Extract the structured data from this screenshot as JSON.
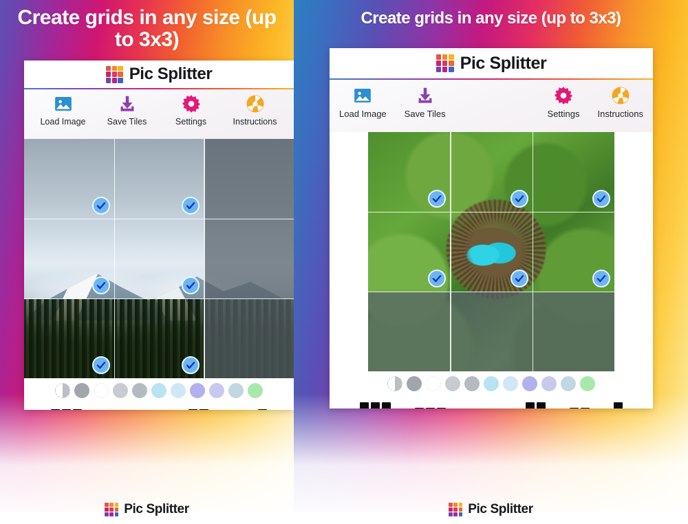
{
  "app": {
    "name": "Pic Splitter",
    "logo_colors": [
      [
        "#e8524a",
        "#f2882c",
        "#fbb321"
      ],
      [
        "#c9246d",
        "#d93a64",
        "#e86a2e"
      ],
      [
        "#7b3fb0",
        "#b2248a",
        "#3f63c4"
      ]
    ]
  },
  "panels": [
    {
      "id": "left",
      "headline": "Create grids in any size (up to 3x3)",
      "toolbar": [
        {
          "label": "Load Image",
          "icon": "image-icon",
          "color": "#2b8fd4"
        },
        {
          "label": "Save Tiles",
          "icon": "download-icon",
          "color": "#8e3fb0"
        },
        {
          "label": "Settings",
          "icon": "gear-icon",
          "color": "#e3197a"
        },
        {
          "label": "Instructions",
          "icon": "help-wheel-icon",
          "color": "#f5a623"
        }
      ],
      "photo": "mountain-landscape",
      "grid": {
        "cols": 3,
        "rows": 3
      },
      "tiles": [
        {
          "selected": true,
          "dimmed": false
        },
        {
          "selected": true,
          "dimmed": false
        },
        {
          "selected": false,
          "dimmed": true
        },
        {
          "selected": true,
          "dimmed": false
        },
        {
          "selected": true,
          "dimmed": false
        },
        {
          "selected": false,
          "dimmed": true
        },
        {
          "selected": true,
          "dimmed": false
        },
        {
          "selected": true,
          "dimmed": false
        },
        {
          "selected": false,
          "dimmed": true
        }
      ],
      "swatches": [
        "half",
        "#a0a6ab",
        "#ffffff",
        "#c8ccd1",
        "#b4bac0",
        "#b8e4f2",
        "#cfe7f6",
        "#b3b0ee",
        "#c9c9ee",
        "#c1d7e4",
        "#a8e8ac"
      ],
      "patterns": [
        {
          "name": "grid-3x3",
          "cols": 3,
          "rows": 3
        },
        {
          "name": "grid-3x2",
          "cols": 3,
          "rows": 2
        },
        {
          "name": "grid-3x1",
          "cols": 3,
          "rows": 1
        },
        {
          "name": "grid-2x3",
          "cols": 2,
          "rows": 3
        },
        {
          "name": "grid-2x2",
          "cols": 2,
          "rows": 2
        },
        {
          "name": "grid-1x3",
          "cols": 1,
          "rows": 3
        }
      ],
      "bottom_bar": {
        "grid_button": "grid-toggle-icon",
        "frame_button": "frame-border-icon"
      }
    },
    {
      "id": "right",
      "headline": "Create grids in any size (up to 3x3)",
      "toolbar": [
        {
          "label": "Load Image",
          "icon": "image-icon",
          "color": "#2b8fd4"
        },
        {
          "label": "Save Tiles",
          "icon": "download-icon",
          "color": "#8e3fb0"
        },
        {
          "label": "Settings",
          "icon": "gear-icon",
          "color": "#e3197a"
        },
        {
          "label": "Instructions",
          "icon": "help-wheel-icon",
          "color": "#f5a623"
        }
      ],
      "photo": "bird-nest-with-eggs",
      "grid": {
        "cols": 3,
        "rows": 3
      },
      "tiles": [
        {
          "selected": true,
          "dimmed": false
        },
        {
          "selected": true,
          "dimmed": false
        },
        {
          "selected": true,
          "dimmed": false
        },
        {
          "selected": true,
          "dimmed": false
        },
        {
          "selected": true,
          "dimmed": false
        },
        {
          "selected": true,
          "dimmed": false
        },
        {
          "selected": false,
          "dimmed": true
        },
        {
          "selected": false,
          "dimmed": true
        },
        {
          "selected": false,
          "dimmed": true
        }
      ],
      "swatches": [
        "half",
        "#a0a6ab",
        "#ffffff",
        "#c8ccd1",
        "#b4bac0",
        "#b8e4f2",
        "#cfe7f6",
        "#b3b0ee",
        "#c9c9ee",
        "#c1d7e4",
        "#a8e8ac"
      ],
      "patterns": [
        {
          "name": "grid-3x3",
          "cols": 3,
          "rows": 3
        },
        {
          "name": "grid-3x2",
          "cols": 3,
          "rows": 2
        },
        {
          "name": "grid-3x1",
          "cols": 3,
          "rows": 1
        },
        {
          "name": "grid-2x3",
          "cols": 2,
          "rows": 3
        },
        {
          "name": "grid-2x2",
          "cols": 2,
          "rows": 2
        },
        {
          "name": "grid-1x3",
          "cols": 1,
          "rows": 3
        }
      ],
      "bottom_bar": {
        "grid_button": "grid-toggle-icon",
        "frame_button": "frame-border-icon"
      }
    }
  ],
  "theme": {
    "check_fill": "#6cb6f0",
    "check_mark": "#1433c9",
    "dim_overlay": "#566068",
    "accent_blue": "#2b8fd4",
    "accent_purple": "#8e3fb0",
    "accent_pink": "#e3197a",
    "accent_orange": "#f5a623"
  }
}
